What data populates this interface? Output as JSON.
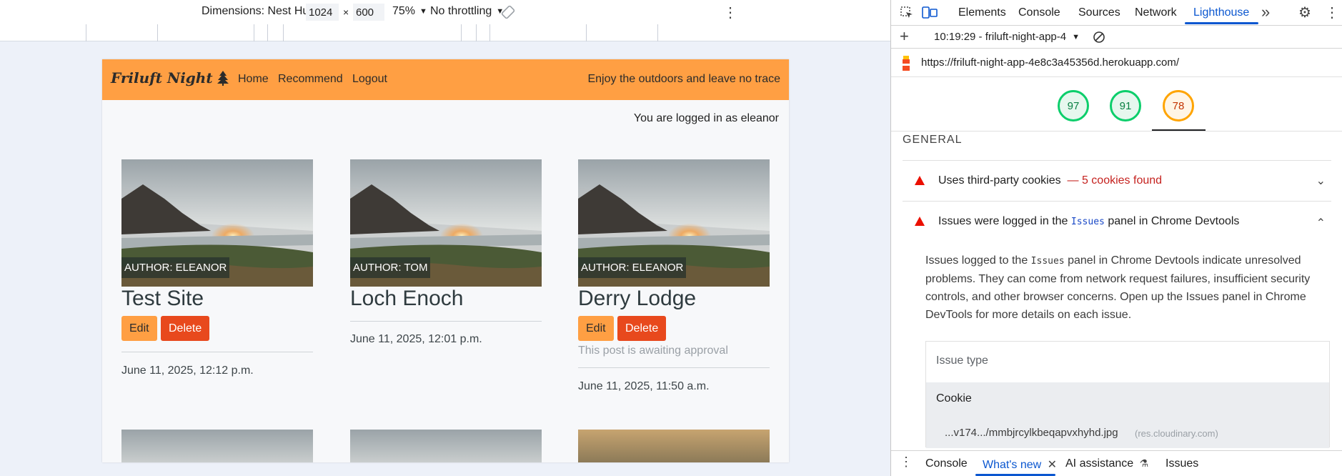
{
  "emulation": {
    "device_label": "Dimensions: Nest Hub",
    "width": "1024",
    "height": "600",
    "times": "×",
    "zoom": "75%",
    "throttling": "No throttling"
  },
  "site": {
    "brand": "Friluft Night",
    "nav": [
      "Home",
      "Recommend",
      "Logout"
    ],
    "tagline": "Enjoy the outdoors and leave no trace",
    "login_status": "You are logged in as eleanor",
    "edit_label": "Edit",
    "delete_label": "Delete",
    "cards": [
      {
        "author": "AUTHOR: ELEANOR",
        "title": "Test Site",
        "date": "June 11, 2025, 12:12 p.m.",
        "pending": ""
      },
      {
        "author": "AUTHOR: TOM",
        "title": "Loch Enoch",
        "date": "June 11, 2025, 12:01 p.m.",
        "pending": ""
      },
      {
        "author": "AUTHOR: ELEANOR",
        "title": "Derry Lodge",
        "date": "June 11, 2025, 11:50 a.m.",
        "pending": "This post is awaiting approval"
      }
    ]
  },
  "devtools": {
    "tabs": [
      "Elements",
      "Console",
      "Sources",
      "Network",
      "Lighthouse"
    ],
    "active_tab": "Lighthouse",
    "more": "»",
    "report_label": "10:19:29 - friluft-night-app-4",
    "url": "https://friluft-night-app-4e8c3a45356d.herokuapp.com/",
    "scores": [
      "97",
      "91",
      "78"
    ],
    "section": "GENERAL",
    "audit1": {
      "title": "Uses third-party cookies",
      "warn": "— 5 cookies found"
    },
    "audit2": {
      "pre": "Issues were logged in the",
      "code": "Issues",
      "post": "panel in Chrome Devtools"
    },
    "desc": {
      "pre": "Issues logged to the",
      "code": "Issues",
      "post": "panel in Chrome Devtools indicate unresolved problems. They can come from network request failures, insufficient security controls, and other browser concerns. Open up the Issues panel in Chrome DevTools for more details on each issue."
    },
    "issue_header": "Issue type",
    "issue_type": "Cookie",
    "issue_url": "...v174.../mmbjrcylkbeqapvxhyhd.jpg",
    "issue_host": "(res.cloudinary.com)",
    "drawer": [
      "Console",
      "What's new",
      "AI assistance",
      "Issues"
    ]
  },
  "colors": {
    "brand_orange": "#ff9f43",
    "delete_red": "#e8491d",
    "devtools_blue": "#0b57d0"
  }
}
